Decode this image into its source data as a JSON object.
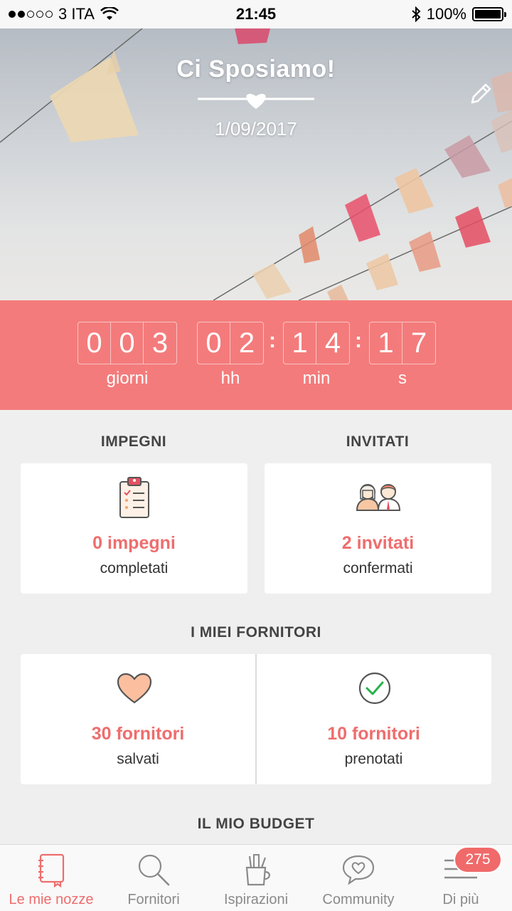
{
  "status_bar": {
    "carrier": "3 ITA",
    "time": "21:45",
    "battery": "100%"
  },
  "hero": {
    "title": "Ci Sposiamo!",
    "date": "1/09/2017"
  },
  "countdown": {
    "days": [
      "0",
      "0",
      "3"
    ],
    "hours": [
      "0",
      "2"
    ],
    "minutes": [
      "1",
      "4"
    ],
    "seconds": [
      "1",
      "7"
    ],
    "labels": {
      "days": "giorni",
      "hours": "hh",
      "minutes": "min",
      "seconds": "s"
    }
  },
  "impegni": {
    "title": "IMPEGNI",
    "count": "0 impegni",
    "sub": "completati"
  },
  "invitati": {
    "title": "INVITATI",
    "count": "2 invitati",
    "sub": "confermati"
  },
  "fornitori": {
    "title": "I MIEI FORNITORI",
    "saved_count": "30 fornitori",
    "saved_sub": "salvati",
    "booked_count": "10 fornitori",
    "booked_sub": "prenotati"
  },
  "budget": {
    "title": "IL MIO BUDGET"
  },
  "tabs": [
    {
      "label": "Le mie nozze",
      "icon": "notebook-icon"
    },
    {
      "label": "Fornitori",
      "icon": "search-icon"
    },
    {
      "label": "Ispirazioni",
      "icon": "pencil-cup-icon"
    },
    {
      "label": "Community",
      "icon": "chat-heart-icon"
    },
    {
      "label": "Di più",
      "icon": "menu-icon"
    }
  ],
  "badge": "275",
  "colors": {
    "accent": "#f47b7b",
    "accent_text": "#ef6d6d",
    "background": "#efefef"
  }
}
